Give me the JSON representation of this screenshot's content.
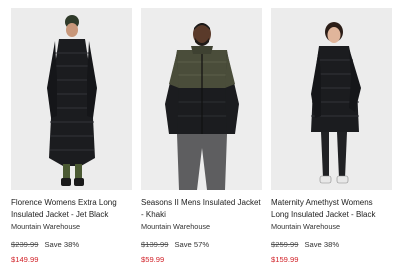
{
  "products": [
    {
      "name": "Florence Womens Extra Long Insulated Jacket - Jet Black",
      "brand": "Mountain Warehouse",
      "was_price": "$239.99",
      "save": "Save 38%",
      "price": "$149.99",
      "image_icon": "woman-long-black-puffer-photo"
    },
    {
      "name": "Seasons II Mens Insulated Jacket - Khaki",
      "brand": "Mountain Warehouse",
      "was_price": "$139.99",
      "save": "Save 57%",
      "price": "$59.99",
      "image_icon": "man-khaki-black-puffer-photo"
    },
    {
      "name": "Maternity Amethyst Womens Long Insulated Jacket - Black",
      "brand": "Mountain Warehouse",
      "was_price": "$259.99",
      "save": "Save 38%",
      "price": "$159.99",
      "image_icon": "woman-maternity-black-puffer-photo"
    }
  ],
  "colors": {
    "sale_price": "#d2232a",
    "photo_background": "#ededed",
    "jacket_black": "#1b1c1f",
    "jacket_khaki": "#4a4d3a"
  }
}
